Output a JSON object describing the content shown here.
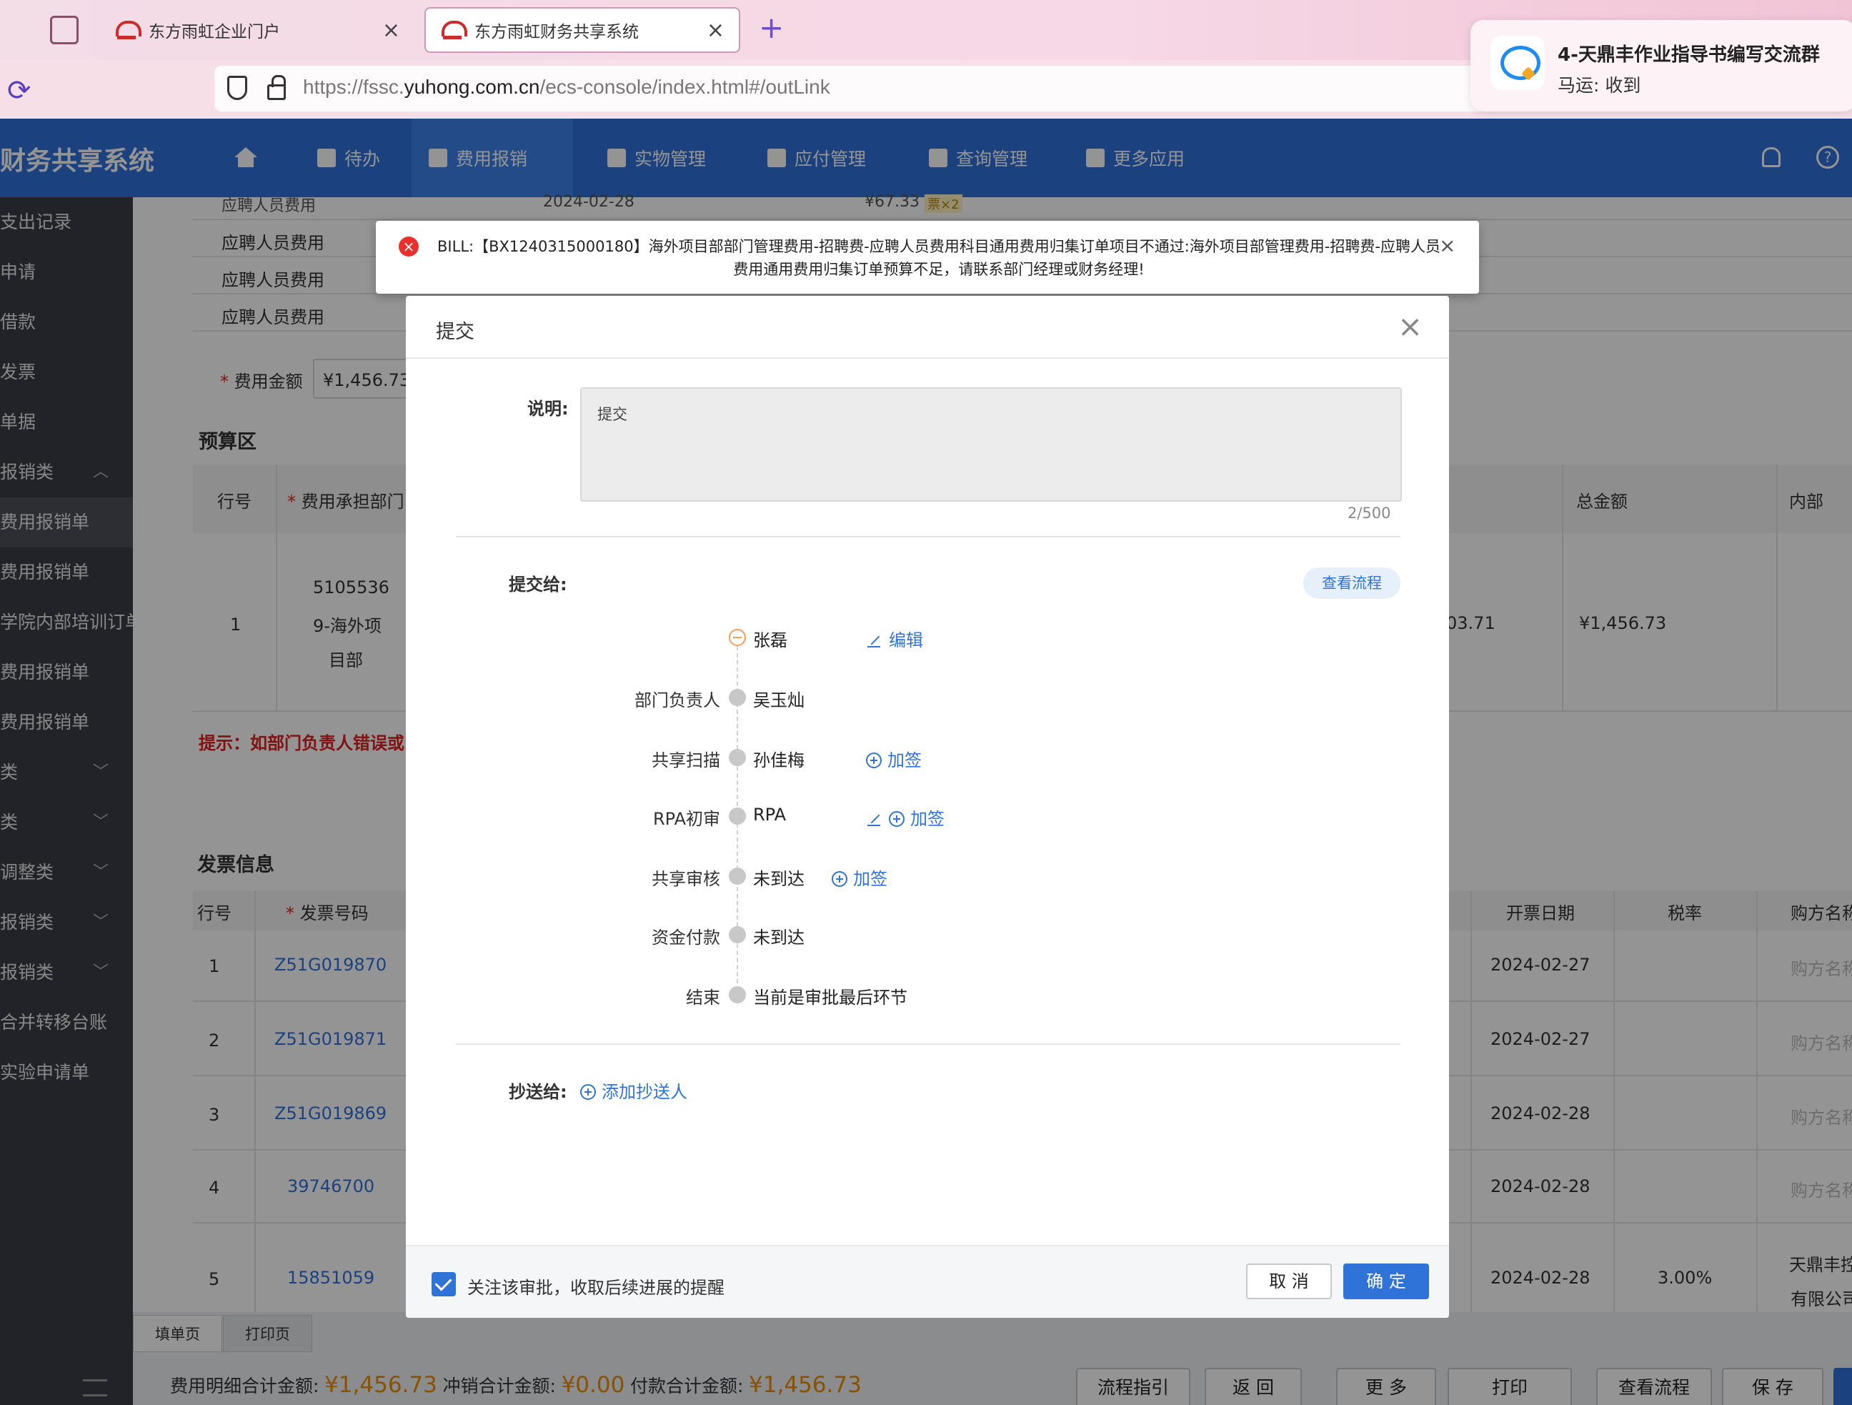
{
  "browser": {
    "tabs": [
      {
        "label": "东方雨虹企业门户",
        "active": false
      },
      {
        "label": "东方雨虹财务共享系统",
        "active": true
      }
    ],
    "url_prefix": "https://fssc.",
    "url_domain": "yuhong.com.cn",
    "url_path": "/ecs-console/index.html#/outLink"
  },
  "notification": {
    "title": "4-天鼎丰作业指导书编写交流群",
    "body": "马运: 收到"
  },
  "app": {
    "title": "财务共享系统",
    "nav": [
      {
        "label": "待办"
      },
      {
        "label": "费用报销",
        "active": true
      },
      {
        "label": "实物管理"
      },
      {
        "label": "应付管理"
      },
      {
        "label": "查询管理"
      },
      {
        "label": "更多应用"
      }
    ]
  },
  "sidebar": {
    "items": [
      {
        "label": "支出记录"
      },
      {
        "label": "申请"
      },
      {
        "label": "借款"
      },
      {
        "label": "发票"
      },
      {
        "label": "单据"
      },
      {
        "label": "报销类",
        "expand": "^"
      },
      {
        "label": "费用报销单",
        "selected": true
      },
      {
        "label": "费用报销单"
      },
      {
        "label": "学院内部培训订单"
      },
      {
        "label": "费用报销单"
      },
      {
        "label": "费用报销单"
      },
      {
        "label": "类",
        "expand": "v"
      },
      {
        "label": "类",
        "expand": "v"
      },
      {
        "label": "调整类",
        "expand": "v"
      },
      {
        "label": "报销类",
        "expand": "v"
      },
      {
        "label": "报销类",
        "expand": "v"
      },
      {
        "label": "合并转移台账"
      },
      {
        "label": "实验申请单"
      }
    ]
  },
  "background": {
    "rows": [
      {
        "type": "应聘人员费用",
        "date": "2024-02-28",
        "amount": "¥67.33",
        "badge": "票×2"
      },
      {
        "type": "应聘人员费用"
      },
      {
        "type": "应聘人员费用"
      },
      {
        "type": "应聘人员费用"
      }
    ],
    "fee_amount_label": "费用金额",
    "fee_amount_value": "¥1,456.73",
    "budget_title": "预算区",
    "budget_headers": {
      "row_no": "行号",
      "dept": "费用承担部门",
      "total": "总金额",
      "inner": "内部"
    },
    "budget_row": {
      "no": "1",
      "dept_line1": "5105536",
      "dept_line2": "9-海外项",
      "dept_line3": "目部",
      "partial": "03.71",
      "total": "¥1,456.73"
    },
    "tip": "提示：如部门负责人错误或",
    "invoice_title": "发票信息",
    "invoice_headers": {
      "row_no": "行号",
      "number": "发票号码",
      "date": "开票日期",
      "tax": "税率",
      "buyer": "购方名称"
    },
    "invoices": [
      {
        "no": "1",
        "number": "Z51G019870",
        "date": "2024-02-27",
        "tax": "",
        "buyer": "购方名称"
      },
      {
        "no": "2",
        "number": "Z51G019871",
        "date": "2024-02-27",
        "tax": "",
        "buyer": "购方名称"
      },
      {
        "no": "3",
        "number": "Z51G019869",
        "date": "2024-02-28",
        "tax": "",
        "buyer": "购方名称"
      },
      {
        "no": "4",
        "number": "39746700",
        "date": "2024-02-28",
        "tax": "",
        "buyer": "购方名称"
      },
      {
        "no": "5",
        "number": "15851059",
        "date": "2024-02-28",
        "tax": "3.00%",
        "buyer_line1": "天鼎丰控",
        "buyer_line2": "有限公司"
      }
    ]
  },
  "page_tabs": {
    "fill": "填单页",
    "print": "打印页"
  },
  "totals": {
    "detail_label": "费用明细合计金额:",
    "detail_value": "¥1,456.73",
    "offset_label": "冲销合计金额:",
    "offset_value": "¥0.00",
    "pay_label": "付款合计金额:",
    "pay_value": "¥1,456.73"
  },
  "bottom_buttons": [
    "流程指引",
    "返 回",
    "更 多",
    "打印",
    "查看流程",
    "保 存"
  ],
  "toast": {
    "message": "BILL:【BX1240315000180】海外项目部部门管理费用-招聘费-应聘人员费用科目通用费用归集订单项目不通过:海外项目部管理费用-招聘费-应聘人员费用通用费用归集订单预算不足，请联系部门经理或财务经理!"
  },
  "dialog": {
    "title": "提交",
    "note_label": "说明:",
    "note_value": "提交",
    "counter": "2/500",
    "submit_to_label": "提交给:",
    "view_flow": "查看流程",
    "flow": [
      {
        "role": "",
        "name": "张磊",
        "actions": [
          "编辑"
        ]
      },
      {
        "role": "部门负责人",
        "name": "吴玉灿",
        "actions": []
      },
      {
        "role": "共享扫描",
        "name": "孙佳梅",
        "actions": [
          "加签"
        ]
      },
      {
        "role": "RPA初审",
        "name": "RPA",
        "actions": [
          "加签"
        ]
      },
      {
        "role": "共享审核",
        "name": "未到达",
        "actions": [
          "加签"
        ]
      },
      {
        "role": "资金付款",
        "name": "未到达",
        "actions": []
      },
      {
        "role": "结束",
        "name": "当前是审批最后环节",
        "actions": []
      }
    ],
    "cc_label": "抄送给:",
    "cc_add": "添加抄送人",
    "follow_label": "关注该审批，收取后续进展的提醒",
    "follow_checked": true,
    "cancel": "取 消",
    "confirm": "确 定"
  },
  "colors": {
    "primary": "#2f73d9",
    "error": "#e6312c",
    "amount": "#f08c00"
  }
}
